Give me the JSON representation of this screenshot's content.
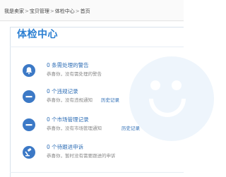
{
  "breadcrumb": {
    "items": [
      "我是卖家",
      "宝贝管理",
      "体检中心",
      "首页"
    ],
    "separator": ">"
  },
  "page": {
    "title": "体检中心"
  },
  "rows": [
    {
      "icon": "bell-icon",
      "title": "0 条需处理的警告",
      "desc": "恭喜你，没有需处理的警告",
      "link": ""
    },
    {
      "icon": "minus-circle-icon",
      "title": "0 个违规记录",
      "desc": "恭喜你，没有违规通知",
      "link": "历史记录"
    },
    {
      "icon": "minus-circle-icon",
      "title": "0 个市场管理记录",
      "desc": "恭喜你，没有市场管理通知",
      "link": "历史记录"
    },
    {
      "icon": "gavel-icon",
      "title": "0 个待跟进申诉",
      "desc": "恭喜你，暂时没有需要跟进的申诉",
      "link": ""
    }
  ],
  "colors": {
    "accent": "#2b7fd2",
    "icon_bg": "#3c79c6",
    "link": "#2d6db5"
  }
}
